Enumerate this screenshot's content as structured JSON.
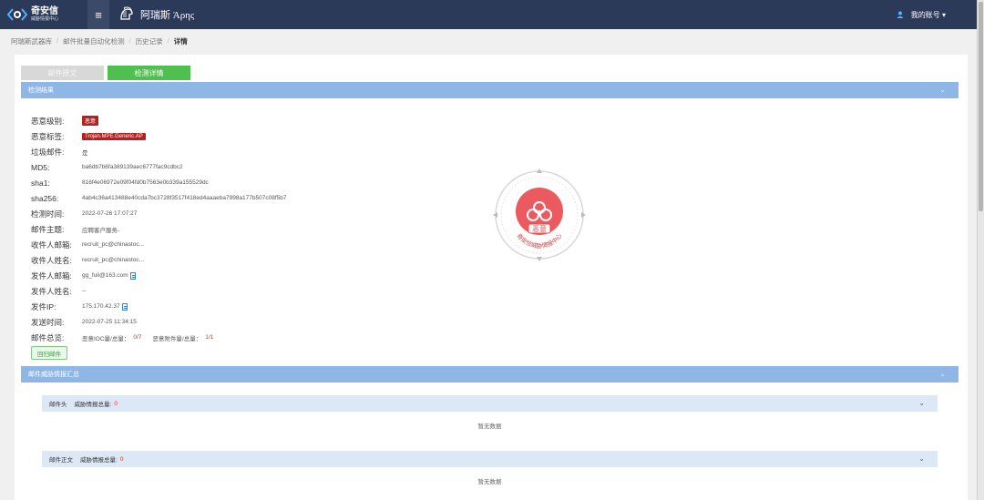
{
  "header": {
    "logo_main": "奇安信",
    "logo_sub": "威胁情报中心",
    "product_name": "阿瑞斯 Άρης",
    "account": "我的账号 ▾"
  },
  "breadcrumb": [
    "阿瑞斯武器库",
    "邮件批量自动化检测",
    "历史记录",
    "详情"
  ],
  "tabs": [
    {
      "label": "邮件原文",
      "active": false
    },
    {
      "label": "检测详情",
      "active": true
    }
  ],
  "detection": {
    "title": "检测结果",
    "fields": [
      {
        "label": "恶意级别:",
        "value": "恶意",
        "type": "badge"
      },
      {
        "label": "恶意标签:",
        "value": "Trojan.MPE.Generic.AP",
        "type": "badge"
      },
      {
        "label": "垃圾邮件:",
        "value": "是"
      },
      {
        "label": "MD5:",
        "value": "ba6db7b6fa389139aec6777fac9cdbc2"
      },
      {
        "label": "sha1:",
        "value": "816f4e06972e09f04fd0b7563e0b339a155529dc"
      },
      {
        "label": "sha256:",
        "value": "4ab4c36a413488e40cda7bc3728f3517f418ed4aaaeba7998a177b507c08f5b7"
      },
      {
        "label": "检测时间:",
        "value": "2022-07-26 17:07:27"
      },
      {
        "label": "邮件主题:",
        "value": "应聘客户服务-"
      },
      {
        "label": "收件人邮箱:",
        "value": "recruit_pc@chinastoc..."
      },
      {
        "label": "收件人姓名:",
        "value": "recruit_pc@chinastoc..."
      },
      {
        "label": "发件人邮箱:",
        "value": "gg_fuli@163.com",
        "icon": "document-icon"
      },
      {
        "label": "发件人姓名:",
        "value": "--"
      },
      {
        "label": "发件IP:",
        "value": "175.170.42.37",
        "icon": "document-icon"
      },
      {
        "label": "发送时间:",
        "value": "2022-07-25 11:34:15"
      },
      {
        "label": "邮件总览:",
        "value": ""
      }
    ],
    "summary": {
      "ioc_label": "恶意IOC量/总量：",
      "ioc_value": "0/7",
      "attach_label": "恶意附件量/总量：",
      "attach_value": "1/1"
    },
    "return_button": "回归邮件",
    "stamp_label": "恶意",
    "stamp_org": "奇安信威胁情报中心"
  },
  "intel": {
    "title": "邮件威胁情报汇总",
    "groups": [
      {
        "name": "邮件头",
        "count_label": "威胁情报总量:",
        "count": "0",
        "empty": "暂无数据"
      },
      {
        "name": "邮件正文",
        "count_label": "威胁情报总量:",
        "count": "0",
        "empty": "暂无数据"
      }
    ]
  },
  "colors": {
    "topbar": "#2c3a5a",
    "section": "#8fb7e6",
    "active_tab": "#4fbf4f",
    "danger": "#b22222"
  }
}
